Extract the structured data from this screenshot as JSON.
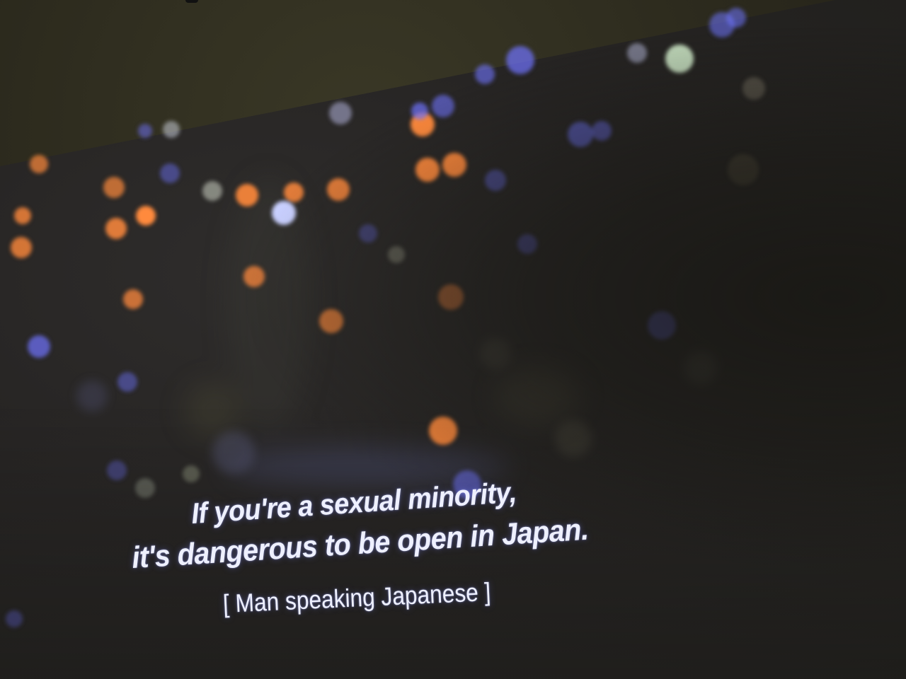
{
  "subtitles": {
    "line1": "If you're a sexual minority,",
    "line2": "it's dangerous to be open in Japan.",
    "caption": "[ Man speaking Japanese ]"
  },
  "colors": {
    "subtitle_text": "#eef0ff",
    "bokeh_orange": "#ff8a3c",
    "bokeh_blue": "#6f74ff",
    "bokeh_white": "#e8f0ff",
    "wall": "#2b2a1f"
  }
}
